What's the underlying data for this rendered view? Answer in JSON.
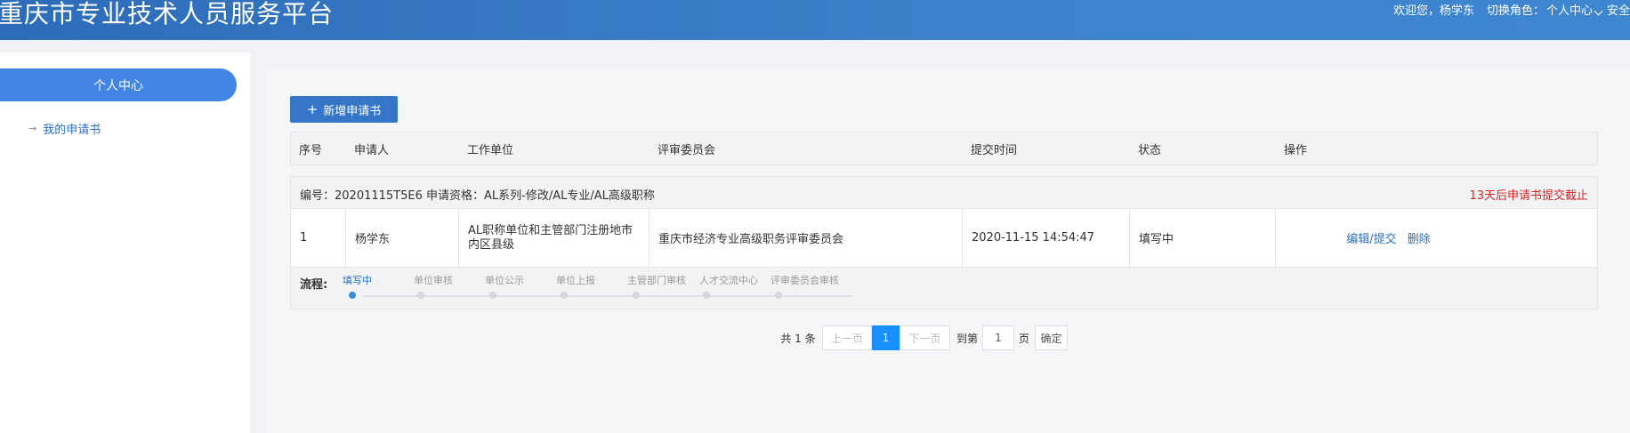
{
  "header": {
    "site_title": "重庆市专业技术人员服务平台",
    "welcome": "欢迎您，杨学东",
    "role_label": "切换角色：",
    "role_value": "个人中心",
    "safety": "安全"
  },
  "sidebar": {
    "section_title": "个人中心",
    "items": [
      {
        "label": "我的申请书"
      }
    ]
  },
  "toolbar": {
    "add_label": "新增申请书"
  },
  "table": {
    "columns": [
      "序号",
      "申请人",
      "工作单位",
      "评审委员会",
      "提交时间",
      "状态",
      "操作"
    ],
    "group": {
      "code_text": "编号：20201115T5E6 申请资格：AL系列-修改/AL专业/AL高级职称",
      "deadline": "13天后申请书提交截止"
    },
    "row": {
      "index": "1",
      "applicant": "杨学东",
      "work_unit": "AL职称单位和主管部门注册地市内区县级",
      "committee": "重庆市经济专业高级职务评审委员会",
      "submit_time": "2020-11-15 14:54:47",
      "status": "填写中",
      "action_edit": "编辑/提交",
      "action_delete": "删除"
    },
    "flow": {
      "label": "流程:",
      "steps": [
        "填写中",
        "单位审核",
        "单位公示",
        "单位上报",
        "主管部门审核",
        "人才交流中心",
        "评审委员会审核"
      ],
      "current_step": 0
    }
  },
  "pagination": {
    "total_text": "共 1 条",
    "prev": "上一页",
    "current_page": "1",
    "next": "下一页",
    "goto_label": "到第",
    "goto_value": "1",
    "page_unit": "页",
    "confirm": "确定"
  }
}
